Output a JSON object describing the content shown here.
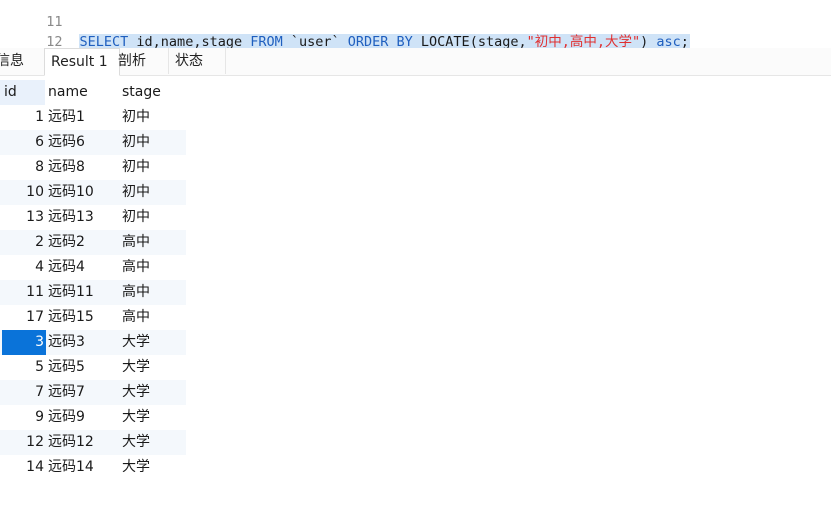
{
  "editor": {
    "lines": [
      {
        "number": "11",
        "text": ""
      },
      {
        "number": "12",
        "tokens": [
          {
            "t": "SELECT ",
            "k": "kw"
          },
          {
            "t": "id,name,stage ",
            "k": "plain"
          },
          {
            "t": "FROM ",
            "k": "kw"
          },
          {
            "t": "`user` ",
            "k": "plain"
          },
          {
            "t": "ORDER BY ",
            "k": "kw"
          },
          {
            "t": "LOCATE(stage,",
            "k": "plain"
          },
          {
            "t": "\"初中,高中,大学\"",
            "k": "str"
          },
          {
            "t": ") ",
            "k": "plain"
          },
          {
            "t": "asc",
            "k": "kw"
          },
          {
            "t": ";",
            "k": "plain"
          }
        ]
      }
    ]
  },
  "tabs": [
    {
      "label": "信息",
      "active": false
    },
    {
      "label": "Result 1",
      "active": true
    },
    {
      "label": "剖析",
      "active": false
    },
    {
      "label": "状态",
      "active": false
    }
  ],
  "table": {
    "columns": [
      "id",
      "name",
      "stage"
    ],
    "rows": [
      [
        "1",
        "远码1",
        "初中"
      ],
      [
        "6",
        "远码6",
        "初中"
      ],
      [
        "8",
        "远码8",
        "初中"
      ],
      [
        "10",
        "远码10",
        "初中"
      ],
      [
        "13",
        "远码13",
        "初中"
      ],
      [
        "2",
        "远码2",
        "高中"
      ],
      [
        "4",
        "远码4",
        "高中"
      ],
      [
        "11",
        "远码11",
        "高中"
      ],
      [
        "17",
        "远码15",
        "高中"
      ],
      [
        "3",
        "远码3",
        "大学"
      ],
      [
        "5",
        "远码5",
        "大学"
      ],
      [
        "7",
        "远码7",
        "大学"
      ],
      [
        "9",
        "远码9",
        "大学"
      ],
      [
        "12",
        "远码12",
        "大学"
      ],
      [
        "14",
        "远码14",
        "大学"
      ]
    ],
    "selected_row": 9
  },
  "colors": {
    "keyword": "#1f5fbf",
    "string": "#e03030",
    "selection": "#0a73d9",
    "code_highlight": "#cfe3f7"
  }
}
